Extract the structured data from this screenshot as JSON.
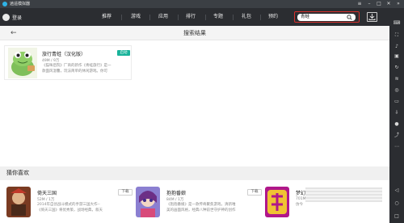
{
  "window": {
    "title": "逍遥模拟器"
  },
  "header": {
    "login_label": "登录",
    "nav": [
      "推荐",
      "游戏",
      "应用",
      "排行",
      "专题",
      "礼包",
      "预约"
    ],
    "search_value": "青蛙"
  },
  "subheader": {
    "title": "搜索结果"
  },
  "result": {
    "name": "旅行青蛙（汉化版）",
    "meta": "49M / 9万",
    "desc_line1": "《猫咪后院》厂商的新作《青蛙旅行》是一",
    "desc_line2": "款面风温馨，玩法简单的休闲游戏。你可",
    "button": "启动"
  },
  "recommend": {
    "title": "猜你喜欢",
    "games": [
      {
        "name": "倚天三国",
        "meta": "52M / 1万",
        "desc_line1": "2014年自创战斗模式的手游三国大作--",
        "desc_line2": "《倚天三国》将优秀策，战场经典，叙天",
        "button": "下载"
      },
      {
        "name": "抱抱番娘",
        "meta": "84M / 1万",
        "desc_line1": "《抱抱番娘》是一款传奇聚焦游戏，清新唯",
        "desc_line2": "美的画面风格，经典八种前世守护神的创作",
        "button": "下载"
      },
      {
        "name": "梦幻",
        "meta": "701M",
        "desc_line1": "仿今"
      }
    ]
  },
  "colors": {
    "accent": "#19b39a",
    "search_border": "#d9302c",
    "chrome": "#2b2d31"
  }
}
